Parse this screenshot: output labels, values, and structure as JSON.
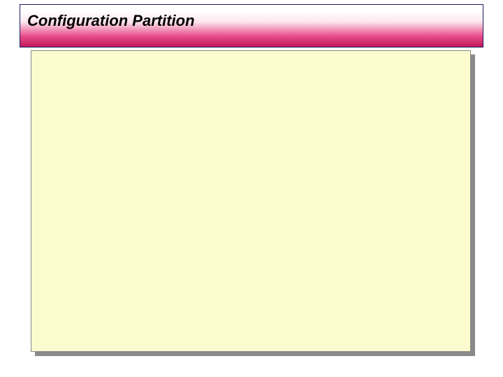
{
  "header": {
    "title": "Configuration Partition"
  },
  "colors": {
    "gradient_start": "#ffffff",
    "gradient_end": "#c1185a",
    "border": "#1a1a5c",
    "panel_bg": "#fbfbcf",
    "shadow": "#8a8a8a"
  }
}
